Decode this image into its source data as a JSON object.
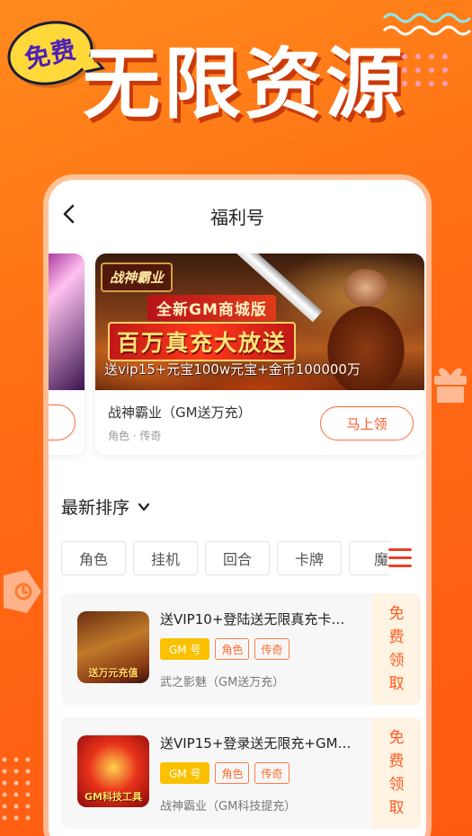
{
  "promo": {
    "bubble_text": "免费",
    "headline": "无限资源"
  },
  "header": {
    "title": "福利号"
  },
  "featured": {
    "banner_logo": "战神霸业",
    "banner_line1": "全新GM商城版",
    "banner_line2": "百万真充大放送",
    "banner_line3": "送vip15+元宝100w元宝+金币100000万",
    "name": "战神霸业（GM送万充）",
    "subtitle": "角色 · 传奇",
    "claim_label": "马上领"
  },
  "sort": {
    "label": "最新排序"
  },
  "categories": [
    "角色",
    "挂机",
    "回合",
    "卡牌",
    "魔"
  ],
  "list": [
    {
      "title": "送VIP10+登陆送无限真充卡…",
      "tag_gm": "GM 号",
      "tags": [
        "角色",
        "传奇"
      ],
      "game": "武之影魅（GM送万充）",
      "thumb_caption": "送万元充值",
      "action": [
        "免",
        "费",
        "领",
        "取"
      ]
    },
    {
      "title": "送VIP15+登录送无限充+GM…",
      "tag_gm": "GM 号",
      "tags": [
        "角色",
        "传奇"
      ],
      "game": "战神霸业（GM科技提充）",
      "thumb_caption": "GM科技工具",
      "action": [
        "免",
        "费",
        "领",
        "取"
      ]
    }
  ],
  "colors": {
    "background": "#ff6a14",
    "accent": "#ff5a2a",
    "gm_tag": "#f9c100"
  }
}
